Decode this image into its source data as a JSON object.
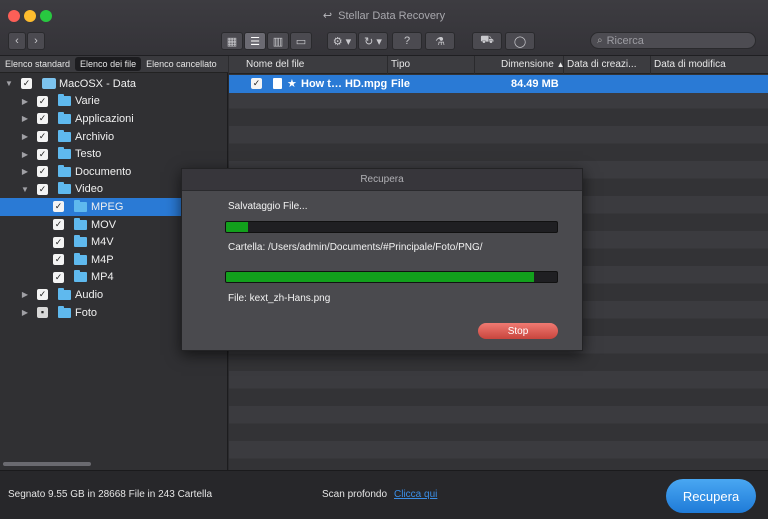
{
  "window": {
    "title": "Stellar Data Recovery"
  },
  "toolbar": {
    "back_icon": "chevron-left-icon",
    "forward_icon": "chevron-right-icon",
    "view_modes": [
      "grid-view-icon",
      "list-view-icon",
      "column-view-icon",
      "coverflow-view-icon"
    ],
    "active_view": "list-view-icon",
    "search_placeholder": "Ricerca"
  },
  "sidebar": {
    "tabs": [
      {
        "label": "Elenco standard",
        "active": false
      },
      {
        "label": "Elenco dei file",
        "active": true
      },
      {
        "label": "Elenco cancellato",
        "active": false
      }
    ],
    "tree": [
      {
        "label": "MacOSX - Data",
        "level": 0,
        "expanded": true,
        "checked": "full",
        "icon": "disk-icon"
      },
      {
        "label": "Varie",
        "level": 1,
        "expanded": false,
        "checked": "full",
        "icon": "folder-icon"
      },
      {
        "label": "Applicazioni",
        "level": 1,
        "expanded": false,
        "checked": "full",
        "icon": "folder-icon"
      },
      {
        "label": "Archivio",
        "level": 1,
        "expanded": false,
        "checked": "full",
        "icon": "folder-icon"
      },
      {
        "label": "Testo",
        "level": 1,
        "expanded": false,
        "checked": "full",
        "icon": "folder-icon"
      },
      {
        "label": "Documento",
        "level": 1,
        "expanded": false,
        "checked": "full",
        "icon": "folder-icon"
      },
      {
        "label": "Video",
        "level": 1,
        "expanded": true,
        "checked": "full",
        "icon": "folder-icon"
      },
      {
        "label": "MPEG",
        "level": 2,
        "checked": "full",
        "icon": "folder-icon",
        "selected": true
      },
      {
        "label": "MOV",
        "level": 2,
        "checked": "full",
        "icon": "folder-icon"
      },
      {
        "label": "M4V",
        "level": 2,
        "checked": "full",
        "icon": "folder-icon"
      },
      {
        "label": "M4P",
        "level": 2,
        "checked": "full",
        "icon": "folder-icon"
      },
      {
        "label": "MP4",
        "level": 2,
        "checked": "full",
        "icon": "folder-icon"
      },
      {
        "label": "Audio",
        "level": 1,
        "expanded": false,
        "checked": "full",
        "icon": "folder-icon"
      },
      {
        "label": "Foto",
        "level": 1,
        "expanded": false,
        "checked": "partial",
        "icon": "folder-icon"
      }
    ]
  },
  "filelist": {
    "columns": [
      "Nome del file",
      "Tipo",
      "Dimensione",
      "Data di creazi...",
      "Data di modifica"
    ],
    "sort_column": "Dimensione",
    "sort_indicator": "▲",
    "rows": [
      {
        "name": "How t… HD.mpg",
        "type": "File",
        "size": "84.49 MB",
        "created": "",
        "modified": "",
        "starred": true
      }
    ]
  },
  "dialog": {
    "title": "Recupera",
    "saving_label": "Salvataggio File...",
    "folder_progress": 0.065,
    "folder_label": "Cartella: /Users/admin/Documents/#Principale/Foto/PNG/",
    "file_progress": 0.93,
    "file_label": "File: kext_zh-Hans.png",
    "stop_label": "Stop"
  },
  "statusbar": {
    "summary": "Segnato 9.55 GB in 28668 File in 243 Cartella",
    "deep_scan_label": "Scan profondo",
    "deep_scan_link": "Clicca qui",
    "recover_label": "Recupera"
  }
}
